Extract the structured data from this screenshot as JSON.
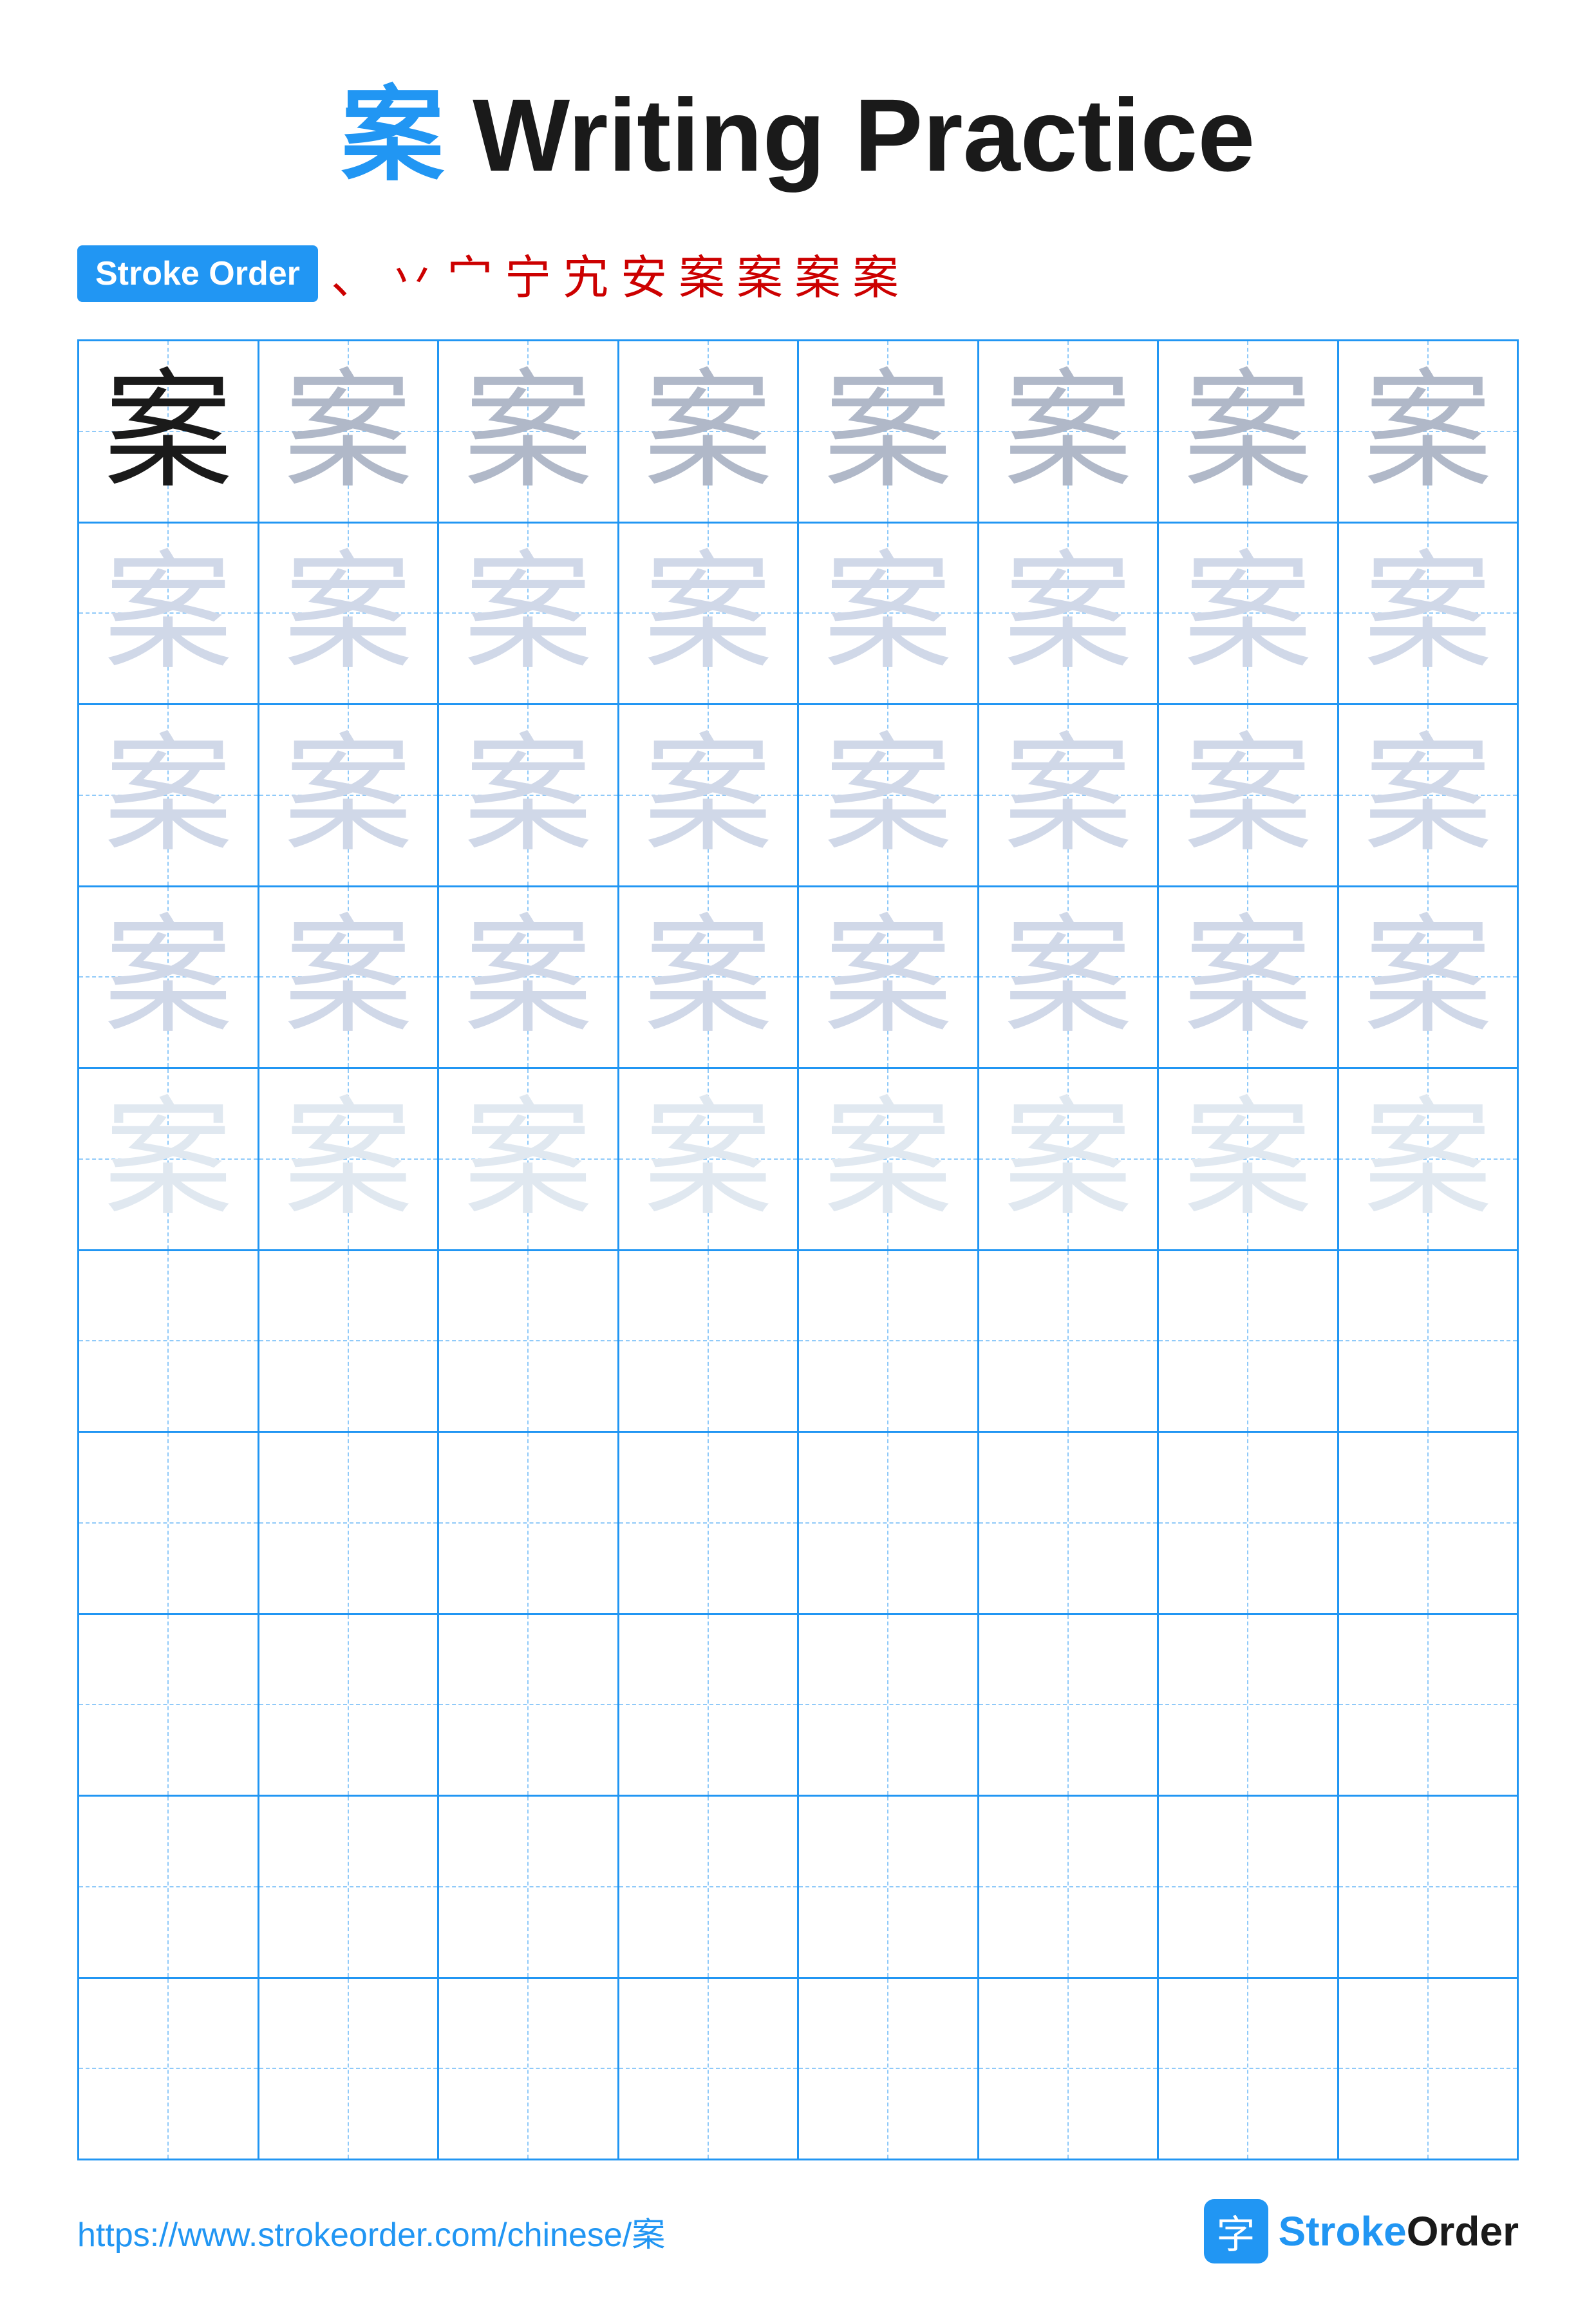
{
  "title": {
    "char": "案",
    "rest": " Writing Practice"
  },
  "stroke_order": {
    "badge_label": "Stroke Order",
    "sequence": [
      "、",
      "丷",
      "宀",
      "宁",
      "宄",
      "安",
      "案",
      "案",
      "案",
      "案"
    ]
  },
  "grid": {
    "rows": 10,
    "cols": 8,
    "character": "案",
    "practice_rows_with_chars": 5,
    "practice_rows_empty": 5
  },
  "footer": {
    "url": "https://www.strokeorder.com/chinese/案",
    "brand_icon": "字",
    "brand_name_stroke": "Stroke",
    "brand_name_order": "Order"
  }
}
